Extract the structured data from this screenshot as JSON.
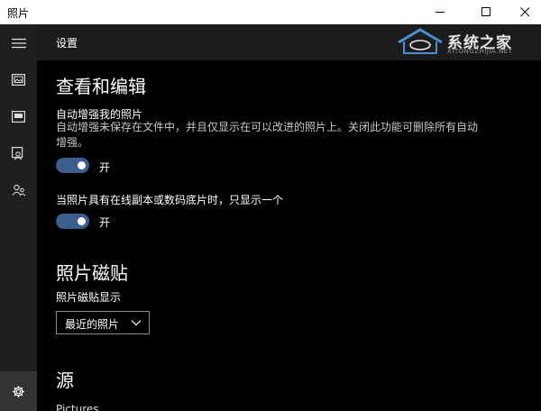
{
  "window": {
    "title": "照片"
  },
  "header": {
    "title": "设置"
  },
  "watermark": {
    "text": "系统之家",
    "subtext": "XITONGZHIJIA.NET"
  },
  "sidebar": {
    "items": [
      {
        "icon": "hamburger-menu-icon"
      },
      {
        "icon": "collection-icon"
      },
      {
        "icon": "albums-icon"
      },
      {
        "icon": "people-icon"
      },
      {
        "icon": "folders-icon"
      },
      {
        "icon": "gear-icon"
      }
    ]
  },
  "sections": {
    "view_edit": {
      "title": "查看和编辑",
      "auto_enhance": {
        "label": "自动增强我的照片",
        "desc": "自动增强未保存在文件中，并且仅显示在可以改进的照片上。关闭此功能可删除所有自动增强。",
        "state": "开"
      },
      "duplicates": {
        "label": "当照片具有在线副本或数码底片时，只显示一个",
        "state": "开"
      }
    },
    "live_tile": {
      "title": "照片磁贴",
      "label": "照片磁贴显示",
      "selected": "最近的照片"
    },
    "sources": {
      "title": "源",
      "first_item": "Pictures"
    }
  },
  "colors": {
    "toggle_on": "#3a5f8f",
    "background": "#000000",
    "sidebar": "#1f1f1f"
  }
}
